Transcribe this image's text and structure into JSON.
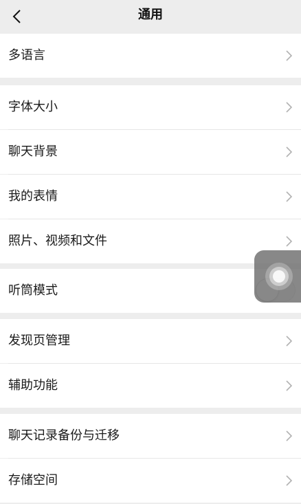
{
  "nav": {
    "title": "通用",
    "back_icon": "chevron-left-icon"
  },
  "sections": [
    {
      "items": [
        {
          "label": "多语言",
          "accessory": "chevron"
        }
      ]
    },
    {
      "items": [
        {
          "label": "字体大小",
          "accessory": "chevron"
        },
        {
          "label": "聊天背景",
          "accessory": "chevron"
        },
        {
          "label": "我的表情",
          "accessory": "chevron"
        },
        {
          "label": "照片、视频和文件",
          "accessory": "chevron"
        }
      ]
    },
    {
      "items": [
        {
          "label": "听筒模式",
          "accessory": "toggle",
          "toggle_on": false
        }
      ]
    },
    {
      "items": [
        {
          "label": "发现页管理",
          "accessory": "chevron"
        },
        {
          "label": "辅助功能",
          "accessory": "chevron"
        }
      ]
    },
    {
      "items": [
        {
          "label": "聊天记录备份与迁移",
          "accessory": "chevron"
        },
        {
          "label": "存储空间",
          "accessory": "chevron"
        }
      ]
    }
  ],
  "colors": {
    "background": "#ededed",
    "cell": "#ffffff",
    "text": "#1a1a1a",
    "chevron": "#b2b2b2"
  },
  "overlay": {
    "icon": "assistive-touch-icon"
  }
}
